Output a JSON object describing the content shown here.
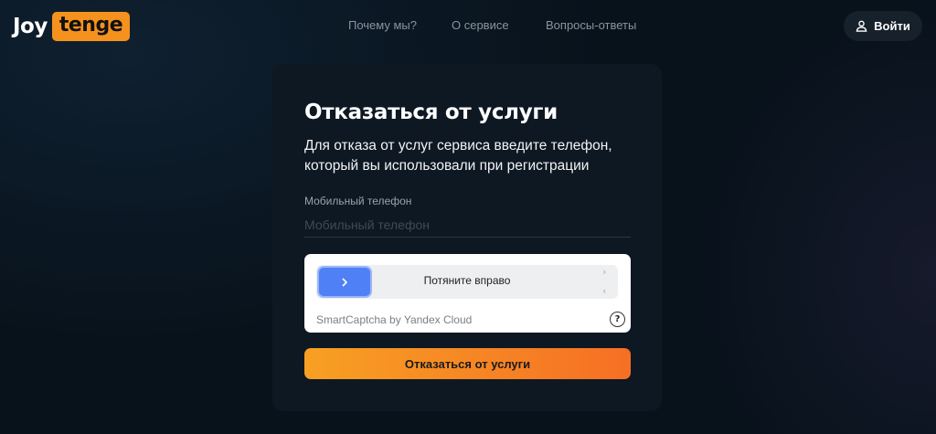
{
  "header": {
    "logo": {
      "part1": "Joy",
      "part2": "tenge"
    },
    "nav": [
      "Почему мы?",
      "О сервисе",
      "Вопросы-ответы"
    ],
    "login_label": "Войти"
  },
  "card": {
    "title": "Отказаться от услуги",
    "subtitle": "Для отказа от услуг сервиса введите телефон, который вы использовали при регистрации",
    "phone_label": "Мобильный телефон",
    "phone_placeholder": "Мобильный телефон",
    "phone_value": "",
    "captcha": {
      "slider_text": "Потяните вправо",
      "brand": "SmartCaptcha by Yandex Cloud",
      "help_icon": "question-circle-icon"
    },
    "submit_label": "Отказаться от услуги"
  },
  "colors": {
    "accent": "#f5921e",
    "background": "#08121b",
    "card": "#0e1822",
    "captcha_handle": "#5080f5",
    "button_gradient_start": "#f7a023",
    "button_gradient_end": "#f66f24"
  }
}
